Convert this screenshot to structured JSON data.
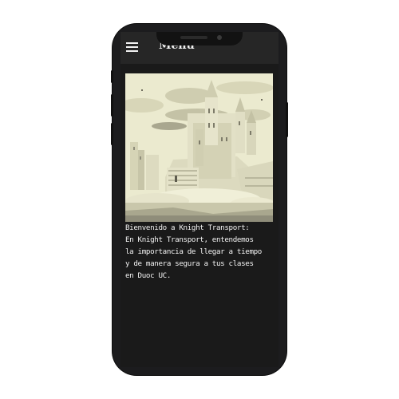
{
  "header": {
    "title": "Menu",
    "menu_icon": "hamburger-icon"
  },
  "hero": {
    "image": "pixel-art-castle"
  },
  "welcome": {
    "lines": [
      "Bienvenido a Knight Transport:",
      "En Knight Transport, entendemos",
      "la importancia de llegar a tiempo",
      "y de manera segura a tus clases",
      "en Duoc UC."
    ]
  },
  "colors": {
    "phone_body": "#1c1c1e",
    "screen_bg": "#1a1a1a",
    "topbar_bg": "#262626",
    "text": "#f4f4f4",
    "art_light": "#e9e8cf",
    "art_mid": "#cfcdb0",
    "art_dark": "#8f8d7a"
  }
}
